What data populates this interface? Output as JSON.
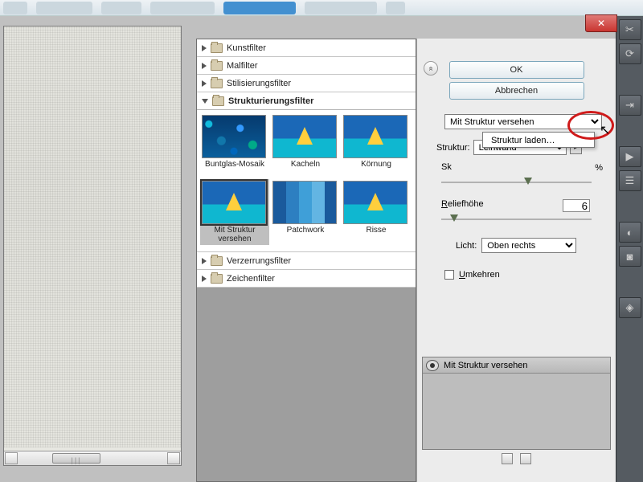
{
  "buttons": {
    "ok": "OK",
    "cancel": "Abbrechen"
  },
  "categories": {
    "kunst": "Kunstfilter",
    "mal": "Malfilter",
    "stil": "Stilisierungsfilter",
    "strukt": "Strukturierungsfilter",
    "verzerr": "Verzerrungsfilter",
    "zeichen": "Zeichenfilter"
  },
  "thumbs": {
    "buntglas": "Buntglas-Mosaik",
    "kacheln": "Kacheln",
    "koernung": "Körnung",
    "mitstruktur": "Mit Struktur versehen",
    "patchwork": "Patchwork",
    "risse": "Risse"
  },
  "filter_select": "Mit Struktur versehen",
  "struktur": {
    "label": "Struktur:",
    "value": "Leinwand"
  },
  "popup_item": "Struktur laden…",
  "skalierung": {
    "label": "Sk",
    "pct": "%"
  },
  "relief": {
    "label": "Reliefhöhe",
    "value": "6"
  },
  "licht": {
    "label": "Licht:",
    "value": "Oben rechts"
  },
  "umkehren": "Umkehren",
  "effect_item": "Mit Struktur versehen"
}
